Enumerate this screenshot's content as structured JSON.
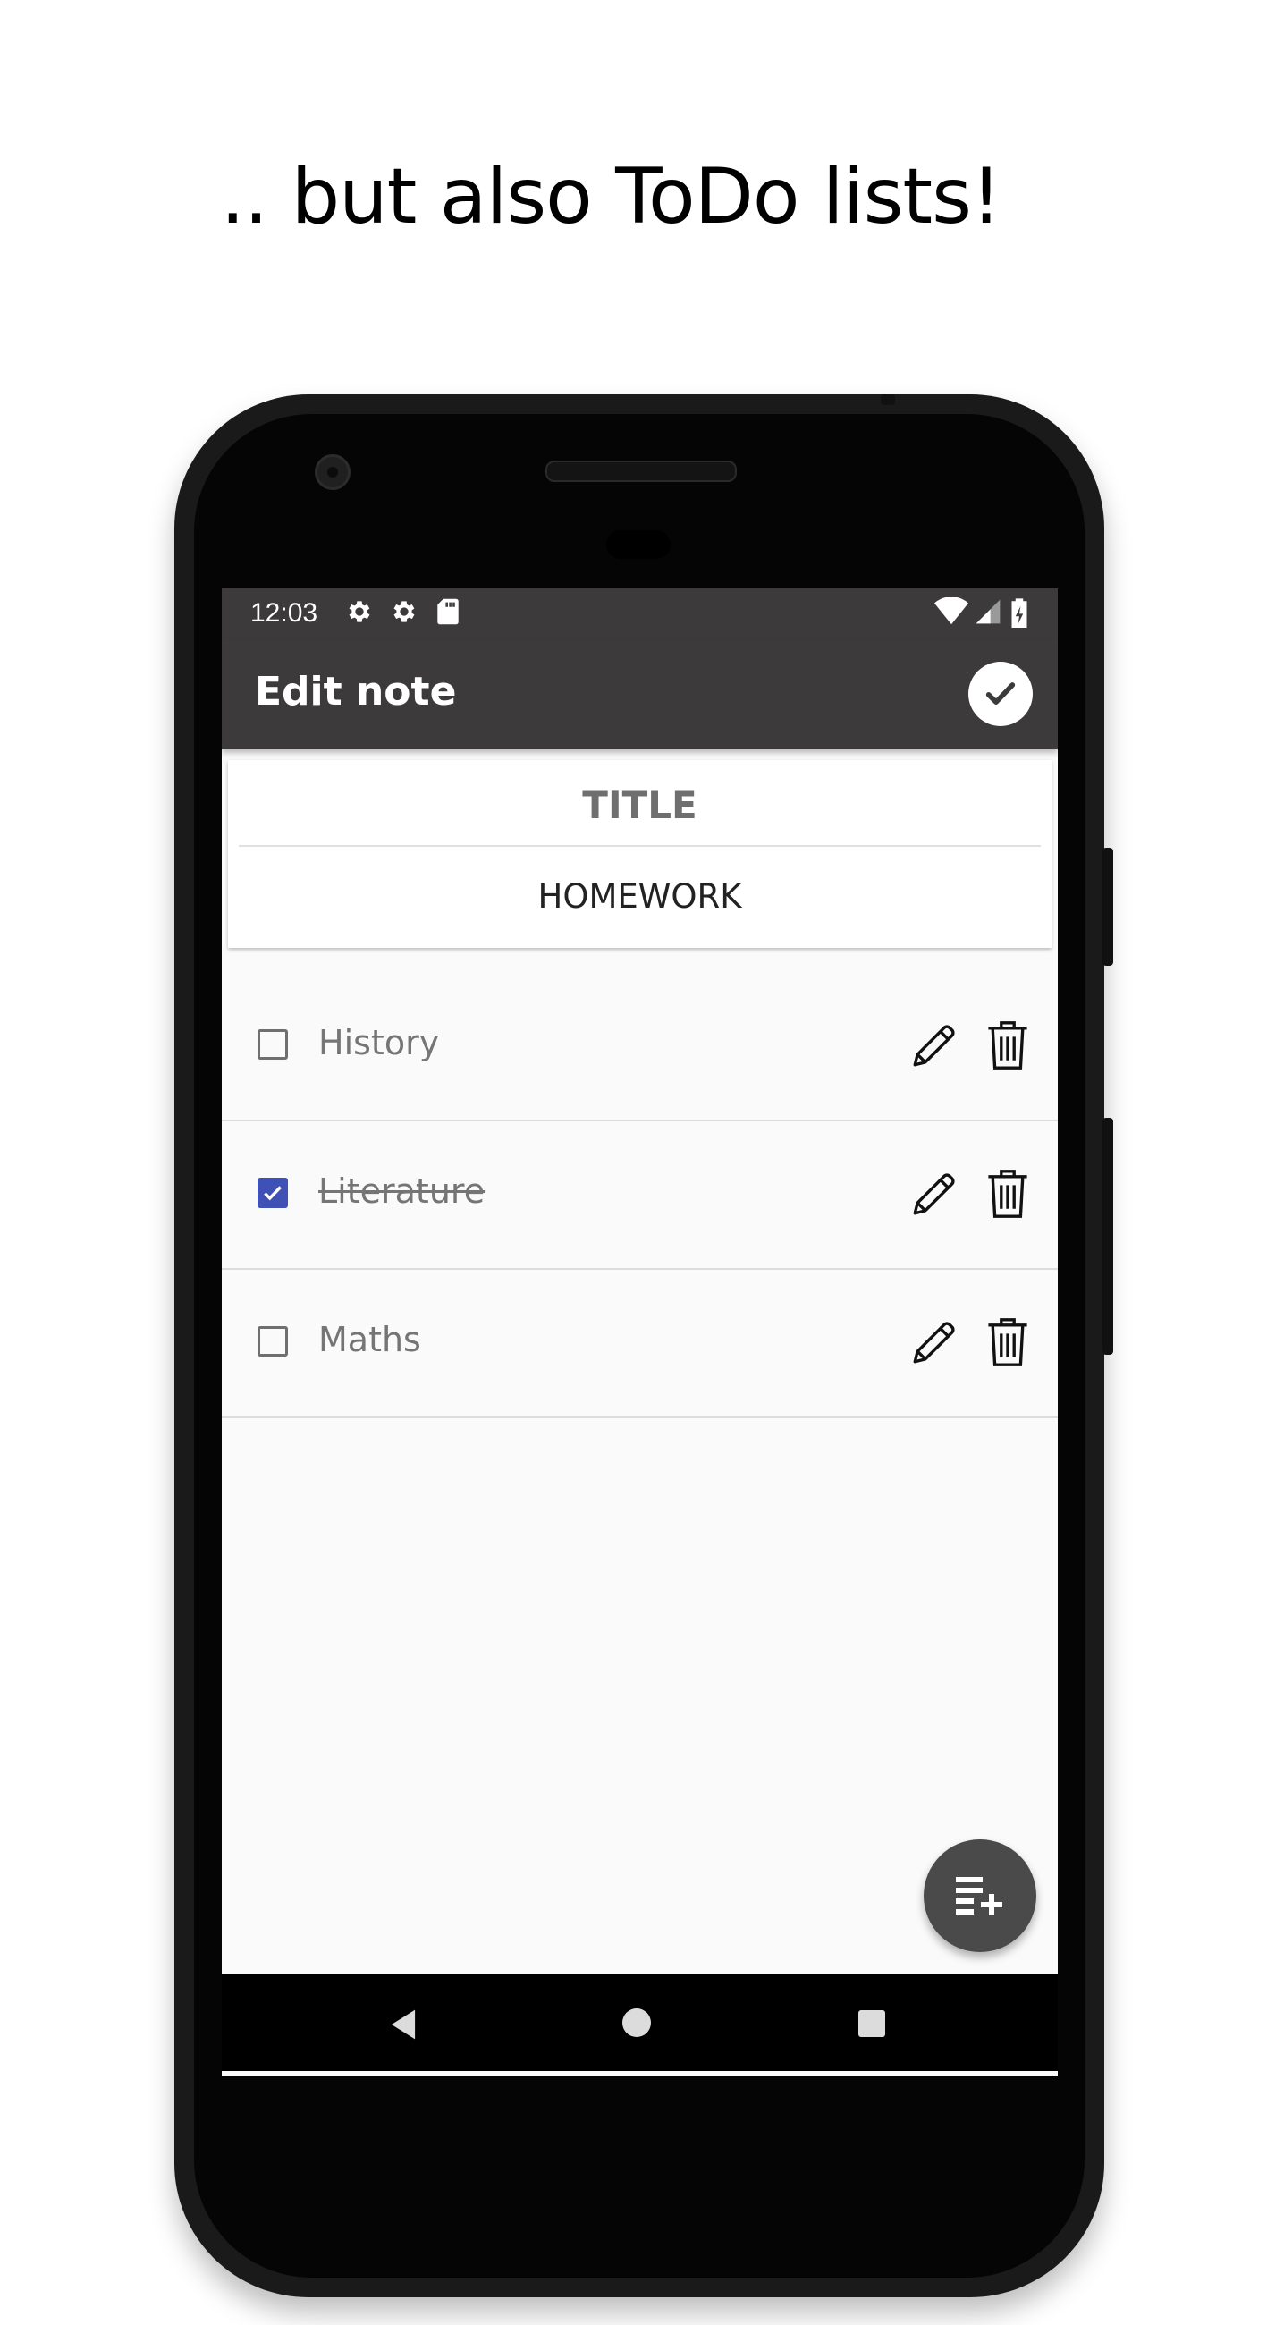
{
  "headline": ".. but also ToDo lists!",
  "status_bar": {
    "time": "12:03",
    "left_icons": [
      "settings-icon",
      "settings-icon",
      "sd-card-icon"
    ],
    "right_icons": [
      "wifi-icon",
      "signal-icon",
      "battery-charging-icon"
    ]
  },
  "app_bar": {
    "title": "Edit note",
    "save_icon": "check-circle-icon"
  },
  "note": {
    "title_label": "TITLE",
    "title_value": "HOMEWORK"
  },
  "todo_items": [
    {
      "label": "History",
      "checked": false
    },
    {
      "label": "Literature",
      "checked": true
    },
    {
      "label": "Maths",
      "checked": false
    }
  ],
  "fab": {
    "icon": "add-list-item-icon"
  },
  "nav_bar": {
    "icons": [
      "back-icon",
      "home-icon",
      "recents-icon"
    ]
  },
  "colors": {
    "app_bar": "#3c3a3a",
    "checkbox_checked": "#3f51b5",
    "fab": "#4a4a4a",
    "screen_background": "#fafafa"
  }
}
